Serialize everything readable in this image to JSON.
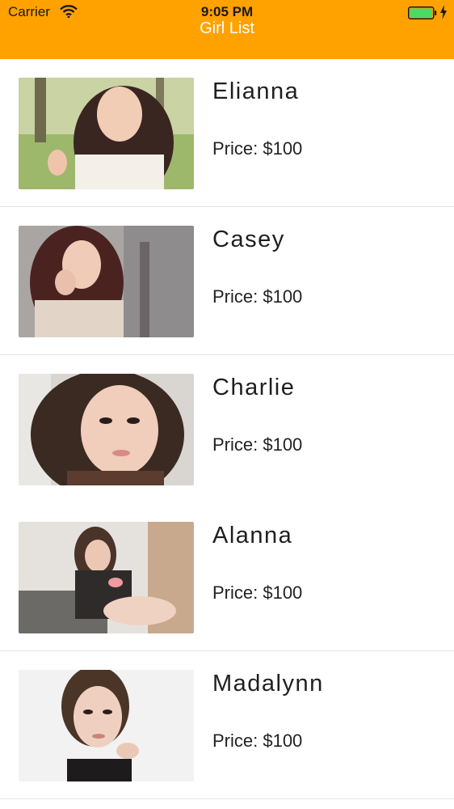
{
  "status_bar": {
    "carrier": "Carrier",
    "time": "9:05 PM",
    "battery_color": "#4cd964"
  },
  "nav": {
    "title": "Girl List",
    "background": "#ffa200"
  },
  "list": {
    "items": [
      {
        "name": "Elianna",
        "price": "Price: $100",
        "photo_icon": "portrait-photo"
      },
      {
        "name": "Casey",
        "price": "Price: $100",
        "photo_icon": "portrait-photo"
      },
      {
        "name": "Charlie",
        "price": "Price: $100",
        "photo_icon": "portrait-photo"
      },
      {
        "name": "Alanna",
        "price": "Price: $100",
        "photo_icon": "portrait-photo"
      },
      {
        "name": "Madalynn",
        "price": "Price: $100",
        "photo_icon": "portrait-photo"
      }
    ]
  }
}
